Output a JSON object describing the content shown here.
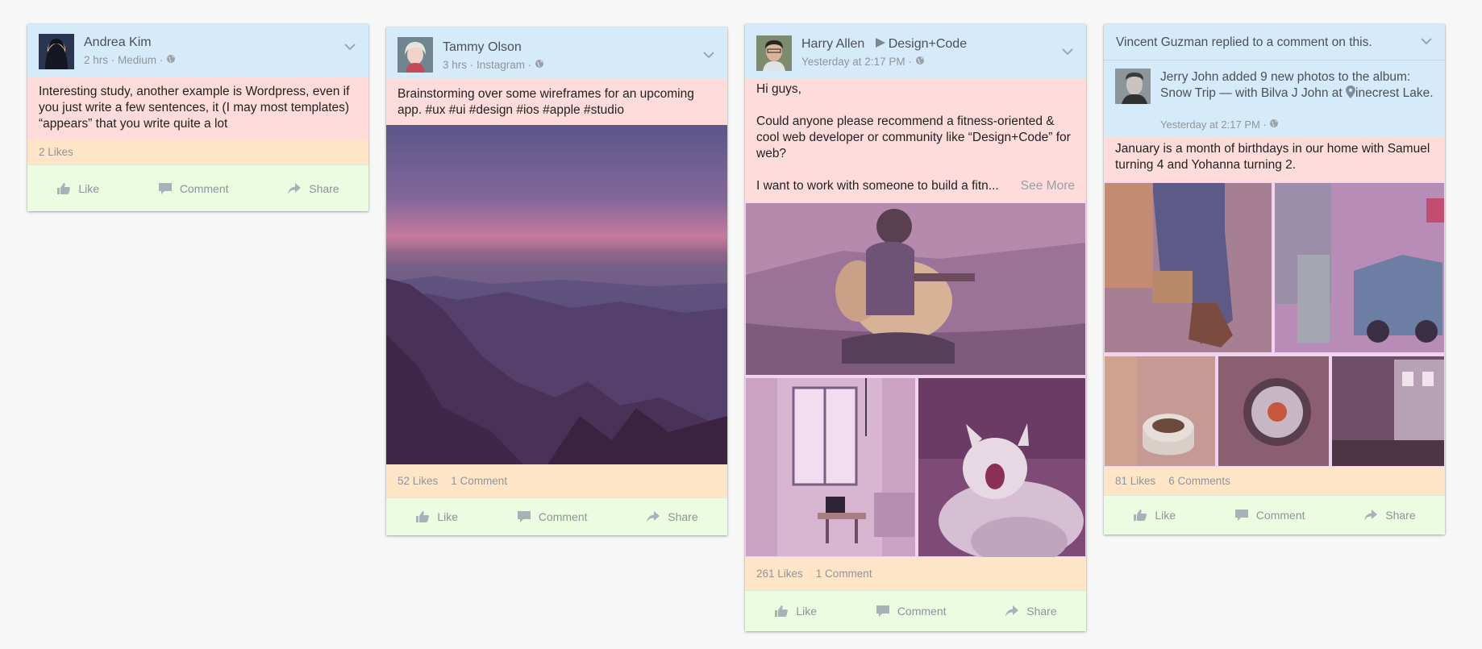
{
  "posts": [
    {
      "author": "Andrea Kim",
      "meta": "2 hrs · Medium ·",
      "text": "Interesting study, another example is Wordpress, even if you just write a few sentences, it (I may most templates) “appears” that you write quite a lot",
      "likes": "2 Likes",
      "actions": {
        "like": "Like",
        "comment": "Comment",
        "share": "Share"
      }
    },
    {
      "author": "Tammy Olson",
      "meta": "3 hrs · Instagram ·",
      "text": "Brainstorming over some wireframes for an upcoming app. #ux #ui #design #ios #apple #studio",
      "likes": "52 Likes",
      "comments": "1 Comment",
      "actions": {
        "like": "Like",
        "comment": "Comment",
        "share": "Share"
      }
    },
    {
      "author": "Harry Allen",
      "page": "Design+Code",
      "meta": "Yesterday at 2:17 PM ·",
      "text_lines": [
        "Hi guys,",
        "Could anyone please recommend a fitness-oriented & cool web developer or community like “Design+Code” for web?",
        "I want to work with someone to build a fitn..."
      ],
      "see_more": "See More",
      "likes": "261 Likes",
      "comments": "1 Comment",
      "actions": {
        "like": "Like",
        "comment": "Comment",
        "share": "Share"
      }
    },
    {
      "notice": "Vincent Guzman replied to a comment on this.",
      "author_line_before": "Jerry John added 9 new photos to the album: Snow Trip — with Bilva J John at",
      "author_line_place": "inecrest Lake.",
      "meta": "Yesterday at 2:17 PM ·",
      "text": "January is a month of birthdays in our home with Samuel turning 4 and Yohanna turning 2.",
      "likes": "81 Likes",
      "comments": "6 Comments",
      "actions": {
        "like": "Like",
        "comment": "Comment",
        "share": "Share"
      }
    }
  ],
  "colors": {
    "header": "#d6ebfa",
    "body": "#ffdcdc",
    "counts": "#ffe5c7",
    "actions": "#ebfce0"
  }
}
